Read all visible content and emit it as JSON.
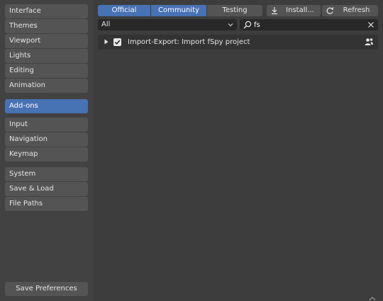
{
  "sidebar": {
    "groups": [
      [
        "Interface",
        "Themes",
        "Viewport",
        "Lights",
        "Editing",
        "Animation"
      ],
      [
        "Add-ons"
      ],
      [
        "Input",
        "Navigation",
        "Keymap"
      ],
      [
        "System",
        "Save & Load",
        "File Paths"
      ]
    ],
    "active": "Add-ons",
    "save_label": "Save Preferences"
  },
  "filter_tabs": {
    "official": "Official",
    "community": "Community",
    "testing": "Testing",
    "selected": [
      "Official",
      "Community"
    ]
  },
  "toolbar": {
    "install_label": "Install...",
    "install_icon": "download-icon",
    "refresh_label": "Refresh",
    "refresh_icon": "refresh-icon"
  },
  "category_dropdown": {
    "value": "All"
  },
  "search": {
    "value": "fs",
    "icon": "search-icon",
    "clear_icon": "close-icon"
  },
  "addons": [
    {
      "name": "Import-Export: Import fSpy project",
      "enabled": true,
      "expanded": false,
      "type_icon": "community-user-icon"
    }
  ],
  "colors": {
    "accent": "#4772b3",
    "background": "#3d3d3d",
    "button": "#545454",
    "field": "#282828"
  }
}
